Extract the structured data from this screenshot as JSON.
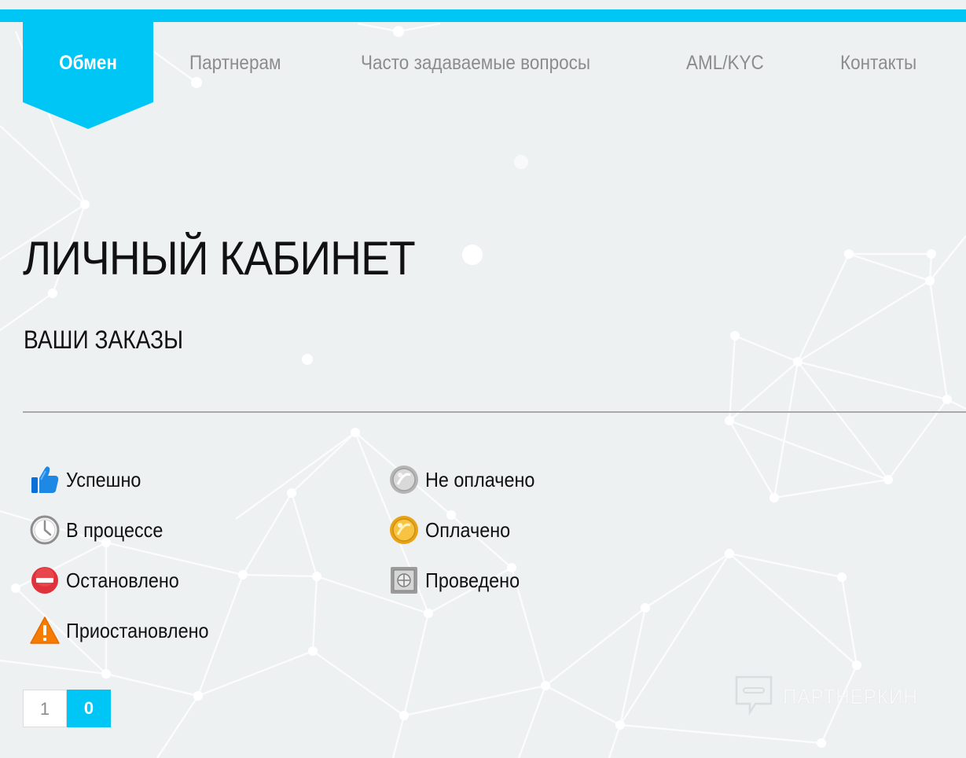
{
  "colors": {
    "accent": "#00c6f6",
    "background": "#eef1f2",
    "text": "#111111",
    "nav_text": "#8c8c8c"
  },
  "nav": {
    "items": [
      {
        "label": "Обмен",
        "active": true
      },
      {
        "label": "Партнерам",
        "active": false
      },
      {
        "label": "Часто задаваемые вопросы",
        "active": false
      },
      {
        "label": "AML/KYC",
        "active": false
      },
      {
        "label": "Контакты",
        "active": false
      }
    ]
  },
  "page": {
    "title": "ЛИЧНЫЙ КАБИНЕТ",
    "section_title": "ВАШИ ЗАКАЗЫ"
  },
  "legend": {
    "items": [
      {
        "label": "Успешно",
        "icon": "thumbs-up-icon"
      },
      {
        "label": "В процессе",
        "icon": "clock-icon"
      },
      {
        "label": "Остановлено",
        "icon": "stop-icon"
      },
      {
        "label": "Приостановлено",
        "icon": "warning-icon"
      },
      {
        "label": "Не оплачено",
        "icon": "silver-coin-icon"
      },
      {
        "label": "Оплачено",
        "icon": "gold-coin-icon"
      },
      {
        "label": "Проведено",
        "icon": "safe-icon"
      }
    ]
  },
  "pagination": {
    "pages": [
      "1",
      "0"
    ],
    "active_index": 1
  },
  "watermark": {
    "text": "ПАРТНЕРКИН",
    "icon": "chat-bubble-icon"
  }
}
